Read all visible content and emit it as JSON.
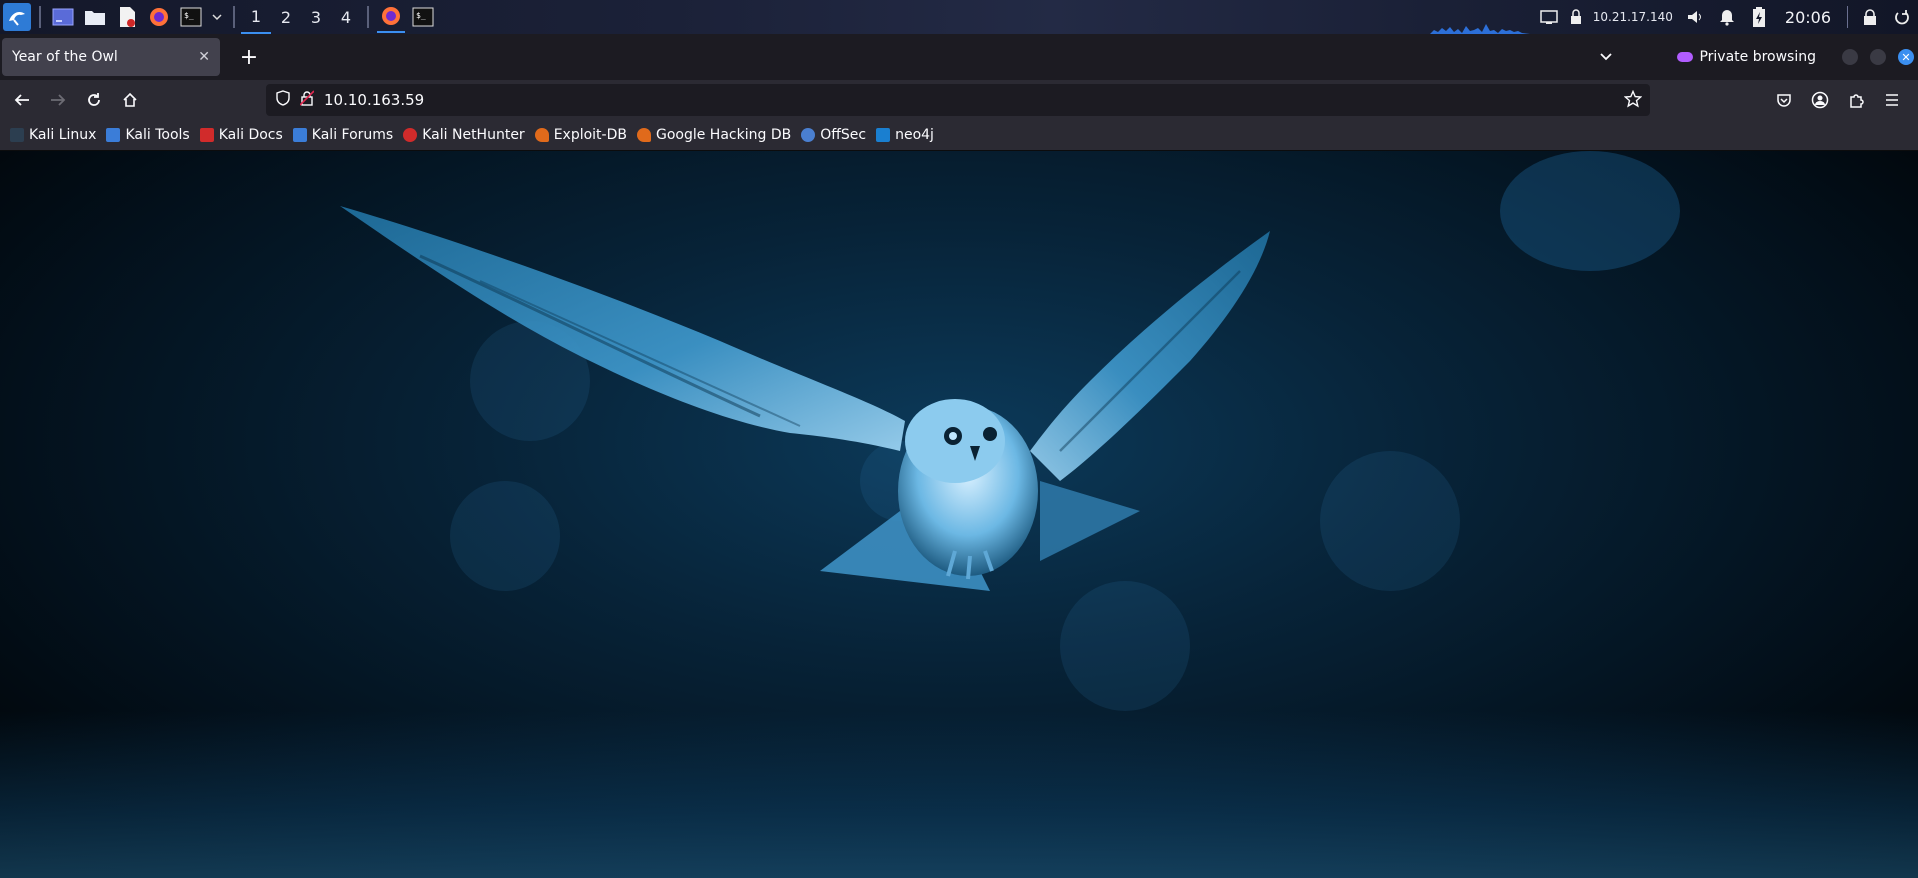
{
  "panel": {
    "workspaces": [
      "1",
      "2",
      "3",
      "4"
    ],
    "active_workspace": "1",
    "ip_address": "10.21.17.140",
    "clock": "20:06",
    "icons": [
      "kali-menu-icon",
      "show-desktop-icon",
      "file-manager-icon",
      "text-editor-icon",
      "firefox-icon",
      "terminal-icon",
      "chevron-down-icon",
      "network-icon",
      "vpn-icon",
      "volume-icon",
      "notification-bell-icon",
      "battery-icon",
      "lock-icon",
      "power-icon"
    ]
  },
  "tabs": [
    {
      "label": "Year of the Owl",
      "active": true
    }
  ],
  "private_browsing_label": "Private browsing",
  "navbar": {
    "url": "10.10.163.59"
  },
  "bookmarks": [
    {
      "label": "Kali Linux",
      "color": "#2c3e50"
    },
    {
      "label": "Kali Tools",
      "color": "#3b7dd8"
    },
    {
      "label": "Kali Docs",
      "color": "#d12b2b"
    },
    {
      "label": "Kali Forums",
      "color": "#3b7dd8"
    },
    {
      "label": "Kali NetHunter",
      "color": "#d12b2b"
    },
    {
      "label": "Exploit-DB",
      "color": "#e06a1b"
    },
    {
      "label": "Google Hacking DB",
      "color": "#e06a1b"
    },
    {
      "label": "OffSec",
      "color": "#4a7fd0"
    },
    {
      "label": "neo4j",
      "color": "#1a7fd0"
    }
  ],
  "colors": {
    "accent": "#3b8ff0",
    "toolbar": "#2b2a33",
    "tabstrip": "#1c1b22",
    "private": "#b15dff"
  },
  "page": {
    "image": "flying-owl-blue"
  }
}
